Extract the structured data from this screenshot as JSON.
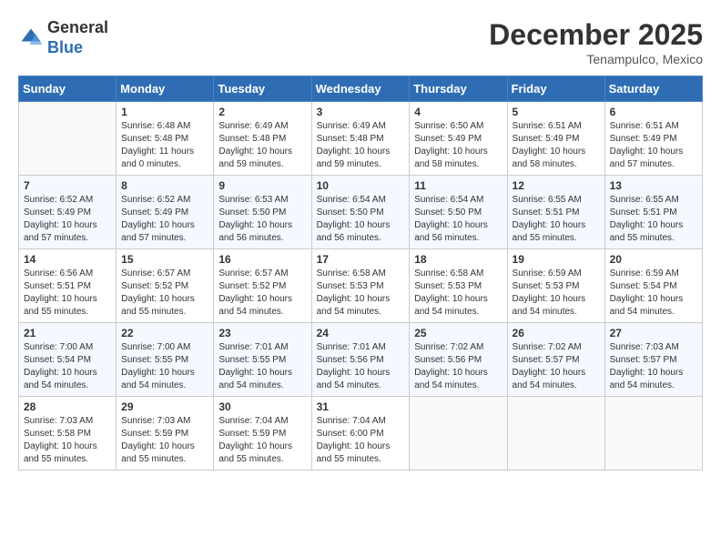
{
  "header": {
    "logo_line1": "General",
    "logo_line2": "Blue",
    "month_title": "December 2025",
    "location": "Tenampulco, Mexico"
  },
  "weekdays": [
    "Sunday",
    "Monday",
    "Tuesday",
    "Wednesday",
    "Thursday",
    "Friday",
    "Saturday"
  ],
  "weeks": [
    [
      {
        "day": "",
        "info": ""
      },
      {
        "day": "1",
        "info": "Sunrise: 6:48 AM\nSunset: 5:48 PM\nDaylight: 11 hours\nand 0 minutes."
      },
      {
        "day": "2",
        "info": "Sunrise: 6:49 AM\nSunset: 5:48 PM\nDaylight: 10 hours\nand 59 minutes."
      },
      {
        "day": "3",
        "info": "Sunrise: 6:49 AM\nSunset: 5:48 PM\nDaylight: 10 hours\nand 59 minutes."
      },
      {
        "day": "4",
        "info": "Sunrise: 6:50 AM\nSunset: 5:49 PM\nDaylight: 10 hours\nand 58 minutes."
      },
      {
        "day": "5",
        "info": "Sunrise: 6:51 AM\nSunset: 5:49 PM\nDaylight: 10 hours\nand 58 minutes."
      },
      {
        "day": "6",
        "info": "Sunrise: 6:51 AM\nSunset: 5:49 PM\nDaylight: 10 hours\nand 57 minutes."
      }
    ],
    [
      {
        "day": "7",
        "info": "Sunrise: 6:52 AM\nSunset: 5:49 PM\nDaylight: 10 hours\nand 57 minutes."
      },
      {
        "day": "8",
        "info": "Sunrise: 6:52 AM\nSunset: 5:49 PM\nDaylight: 10 hours\nand 57 minutes."
      },
      {
        "day": "9",
        "info": "Sunrise: 6:53 AM\nSunset: 5:50 PM\nDaylight: 10 hours\nand 56 minutes."
      },
      {
        "day": "10",
        "info": "Sunrise: 6:54 AM\nSunset: 5:50 PM\nDaylight: 10 hours\nand 56 minutes."
      },
      {
        "day": "11",
        "info": "Sunrise: 6:54 AM\nSunset: 5:50 PM\nDaylight: 10 hours\nand 56 minutes."
      },
      {
        "day": "12",
        "info": "Sunrise: 6:55 AM\nSunset: 5:51 PM\nDaylight: 10 hours\nand 55 minutes."
      },
      {
        "day": "13",
        "info": "Sunrise: 6:55 AM\nSunset: 5:51 PM\nDaylight: 10 hours\nand 55 minutes."
      }
    ],
    [
      {
        "day": "14",
        "info": "Sunrise: 6:56 AM\nSunset: 5:51 PM\nDaylight: 10 hours\nand 55 minutes."
      },
      {
        "day": "15",
        "info": "Sunrise: 6:57 AM\nSunset: 5:52 PM\nDaylight: 10 hours\nand 55 minutes."
      },
      {
        "day": "16",
        "info": "Sunrise: 6:57 AM\nSunset: 5:52 PM\nDaylight: 10 hours\nand 54 minutes."
      },
      {
        "day": "17",
        "info": "Sunrise: 6:58 AM\nSunset: 5:53 PM\nDaylight: 10 hours\nand 54 minutes."
      },
      {
        "day": "18",
        "info": "Sunrise: 6:58 AM\nSunset: 5:53 PM\nDaylight: 10 hours\nand 54 minutes."
      },
      {
        "day": "19",
        "info": "Sunrise: 6:59 AM\nSunset: 5:53 PM\nDaylight: 10 hours\nand 54 minutes."
      },
      {
        "day": "20",
        "info": "Sunrise: 6:59 AM\nSunset: 5:54 PM\nDaylight: 10 hours\nand 54 minutes."
      }
    ],
    [
      {
        "day": "21",
        "info": "Sunrise: 7:00 AM\nSunset: 5:54 PM\nDaylight: 10 hours\nand 54 minutes."
      },
      {
        "day": "22",
        "info": "Sunrise: 7:00 AM\nSunset: 5:55 PM\nDaylight: 10 hours\nand 54 minutes."
      },
      {
        "day": "23",
        "info": "Sunrise: 7:01 AM\nSunset: 5:55 PM\nDaylight: 10 hours\nand 54 minutes."
      },
      {
        "day": "24",
        "info": "Sunrise: 7:01 AM\nSunset: 5:56 PM\nDaylight: 10 hours\nand 54 minutes."
      },
      {
        "day": "25",
        "info": "Sunrise: 7:02 AM\nSunset: 5:56 PM\nDaylight: 10 hours\nand 54 minutes."
      },
      {
        "day": "26",
        "info": "Sunrise: 7:02 AM\nSunset: 5:57 PM\nDaylight: 10 hours\nand 54 minutes."
      },
      {
        "day": "27",
        "info": "Sunrise: 7:03 AM\nSunset: 5:57 PM\nDaylight: 10 hours\nand 54 minutes."
      }
    ],
    [
      {
        "day": "28",
        "info": "Sunrise: 7:03 AM\nSunset: 5:58 PM\nDaylight: 10 hours\nand 55 minutes."
      },
      {
        "day": "29",
        "info": "Sunrise: 7:03 AM\nSunset: 5:59 PM\nDaylight: 10 hours\nand 55 minutes."
      },
      {
        "day": "30",
        "info": "Sunrise: 7:04 AM\nSunset: 5:59 PM\nDaylight: 10 hours\nand 55 minutes."
      },
      {
        "day": "31",
        "info": "Sunrise: 7:04 AM\nSunset: 6:00 PM\nDaylight: 10 hours\nand 55 minutes."
      },
      {
        "day": "",
        "info": ""
      },
      {
        "day": "",
        "info": ""
      },
      {
        "day": "",
        "info": ""
      }
    ]
  ]
}
